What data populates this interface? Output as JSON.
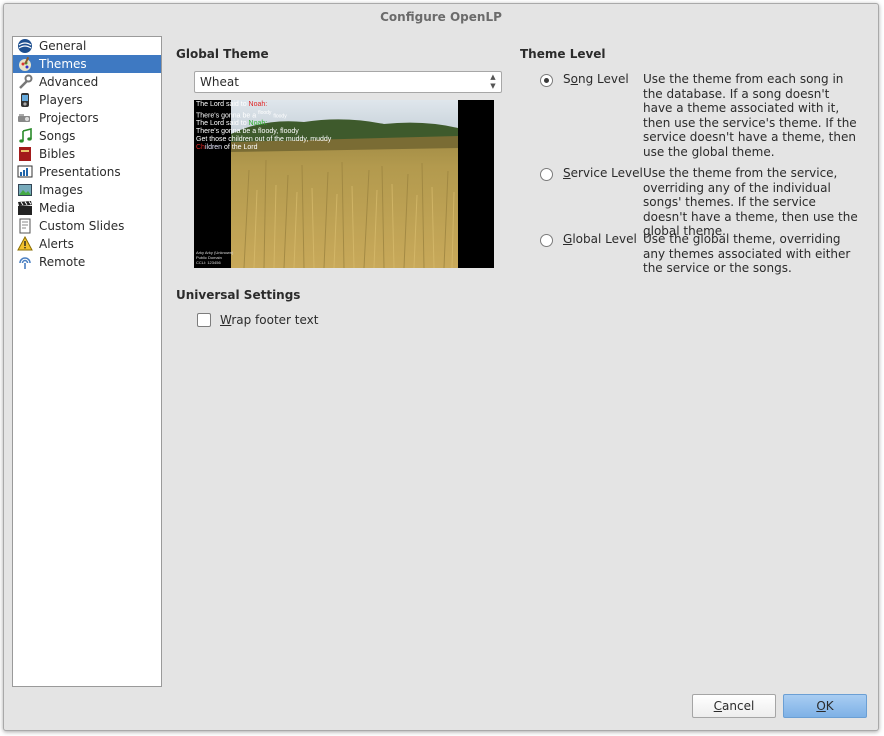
{
  "window": {
    "title": "Configure OpenLP"
  },
  "sidebar": {
    "items": [
      {
        "label": "General",
        "icon": "openlp-globe-icon",
        "selected": false
      },
      {
        "label": "Themes",
        "icon": "themes-paintbrush-icon",
        "selected": true
      },
      {
        "label": "Advanced",
        "icon": "wrench-icon",
        "selected": false
      },
      {
        "label": "Players",
        "icon": "media-player-icon",
        "selected": false
      },
      {
        "label": "Projectors",
        "icon": "projector-icon",
        "selected": false
      },
      {
        "label": "Songs",
        "icon": "music-note-icon",
        "selected": false
      },
      {
        "label": "Bibles",
        "icon": "bible-book-icon",
        "selected": false
      },
      {
        "label": "Presentations",
        "icon": "presentation-chart-icon",
        "selected": false
      },
      {
        "label": "Images",
        "icon": "image-icon",
        "selected": false
      },
      {
        "label": "Media",
        "icon": "clapperboard-icon",
        "selected": false
      },
      {
        "label": "Custom Slides",
        "icon": "custom-slide-icon",
        "selected": false
      },
      {
        "label": "Alerts",
        "icon": "warning-icon",
        "selected": false
      },
      {
        "label": "Remote",
        "icon": "remote-signal-icon",
        "selected": false
      }
    ]
  },
  "global_theme": {
    "heading": "Global Theme",
    "selected": "Wheat",
    "preview": {
      "line1_a": "The Lord said to",
      "line1_b": "Noah:",
      "line2_a": "There's gonna be a",
      "line2_b": "floody",
      "line2_c": "floody",
      "line3_a": "The Lord said to",
      "line3_b": "Noah:",
      "line4": "There's gonna be a floody, floody",
      "line5": "Get those children out of the muddy, muddy",
      "line6_a": "Ch",
      "line6_b": "ildren",
      "line6_c": "of the Lord",
      "footer1": "Arky Arky (Unknown)",
      "footer2": "Public Domain",
      "footer3": "CCLI: 123456"
    }
  },
  "universal": {
    "heading": "Universal Settings",
    "wrap_footer_prefix": "W",
    "wrap_footer_rest": "rap footer text",
    "wrap_footer_checked": false
  },
  "theme_level": {
    "heading": "Theme Level",
    "options": [
      {
        "label_prefix": "S",
        "label_mnemonic": "o",
        "label_rest": "ng Level",
        "selected": true,
        "description": "Use the theme from each song in the database. If a song doesn't have a theme associated with it, then use the service's theme. If the service doesn't have a theme, then use the global theme."
      },
      {
        "label_prefix": "",
        "label_mnemonic": "S",
        "label_rest": "ervice Level",
        "selected": false,
        "description": "Use the theme from the service, overriding any of the individual songs' themes. If the service doesn't have a theme, then use the global theme."
      },
      {
        "label_prefix": "",
        "label_mnemonic": "G",
        "label_rest": "lobal Level",
        "selected": false,
        "description": "Use the global theme, overriding any themes associated with either the service or the songs."
      }
    ]
  },
  "buttons": {
    "cancel_mnemonic": "C",
    "cancel_rest": "ancel",
    "ok_mnemonic": "O",
    "ok_rest": "K"
  },
  "colors": {
    "selection": "#3e79c2",
    "ok_button": "#8fbdeb",
    "dialog_bg": "#e4e4e4"
  }
}
